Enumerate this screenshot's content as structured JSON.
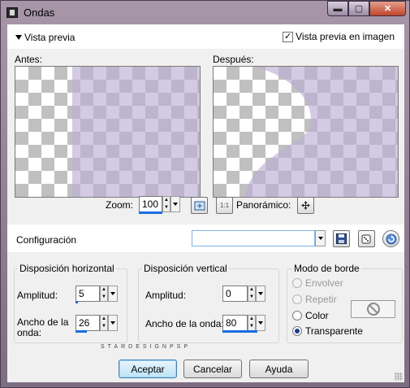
{
  "window": {
    "title": "Ondas",
    "buttons": {
      "minimize": "▬",
      "maximize": "▢",
      "close": "✕"
    }
  },
  "preview": {
    "toggle_label": "Vista previa",
    "preview_in_image_label": "Vista previa en imagen",
    "preview_in_image_checked": true,
    "before_label": "Antes:",
    "after_label": "Después:",
    "overlay_color": "#cbc0dc"
  },
  "zoom": {
    "label": "Zoom:",
    "value": "100",
    "pan_label": "Panorámico:",
    "fit_icon_text": "1:1"
  },
  "config": {
    "label": "Configuración",
    "selected_value": ""
  },
  "horizontal": {
    "title": "Disposición horizontal",
    "amplitude_label": "Amplitud:",
    "amplitude_value": "5",
    "wavelength_label_line1": "Ancho de la",
    "wavelength_label_line2": "onda:",
    "wavelength_value": "26"
  },
  "vertical": {
    "title": "Disposición vertical",
    "amplitude_label": "Amplitud:",
    "amplitude_value": "0",
    "wavelength_label": "Ancho de la onda:",
    "wavelength_value": "80"
  },
  "edge_mode": {
    "title": "Modo de borde",
    "options": [
      {
        "label": "Envolver",
        "selected": false,
        "enabled": false
      },
      {
        "label": "Repetir",
        "selected": false,
        "enabled": false
      },
      {
        "label": "Color",
        "selected": false,
        "enabled": true
      },
      {
        "label": "Transparente",
        "selected": true,
        "enabled": true
      }
    ]
  },
  "watermark": "STARDESIGNPSP",
  "buttons": {
    "accept": "Aceptar",
    "cancel": "Cancelar",
    "help": "Ayuda"
  },
  "colors": {
    "accent": "#1a6de0",
    "window_frame": "#9b8a9f"
  }
}
